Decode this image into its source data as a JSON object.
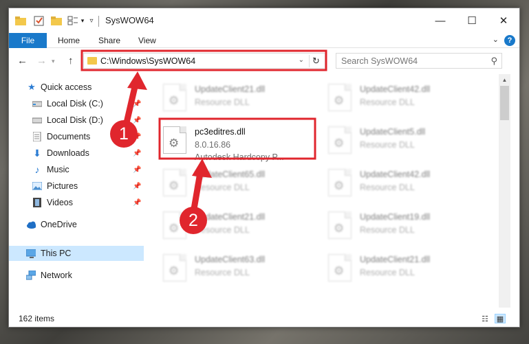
{
  "window": {
    "title": "SysWOW64",
    "controls": {
      "minimize": "—",
      "maximize": "☐",
      "close": "✕"
    }
  },
  "ribbon": {
    "tabs": [
      "File",
      "Home",
      "Share",
      "View"
    ],
    "help": "?"
  },
  "address_bar": {
    "path": "C:\\Windows\\SysWOW64"
  },
  "search": {
    "placeholder": "Search SysWOW64"
  },
  "sidebar": {
    "quick_access": "Quick access",
    "items": [
      {
        "label": "Local Disk (C:)",
        "icon": "drive-icon",
        "pinned": true
      },
      {
        "label": "Local Disk (D:)",
        "icon": "drive-icon",
        "pinned": true
      },
      {
        "label": "Documents",
        "icon": "documents-icon",
        "pinned": true
      },
      {
        "label": "Downloads",
        "icon": "downloads-icon",
        "pinned": true
      },
      {
        "label": "Music",
        "icon": "music-icon",
        "pinned": true
      },
      {
        "label": "Pictures",
        "icon": "pictures-icon",
        "pinned": true
      },
      {
        "label": "Videos",
        "icon": "videos-icon",
        "pinned": true
      }
    ],
    "onedrive": "OneDrive",
    "this_pc": "This PC",
    "network": "Network"
  },
  "files": {
    "highlighted": {
      "name": "pc3editres.dll",
      "version": "8.0.16.86",
      "description": "Autodesk Hardcopy P..."
    },
    "blurred": [
      {
        "name": "UpdateClient21.dll",
        "desc": "Resource DLL"
      },
      {
        "name": "UpdateClient42.dll",
        "desc": "Resource DLL"
      },
      {
        "name": "UpdateClient5.dll",
        "desc": "Resource DLL"
      },
      {
        "name": "UpdateClient65.dll",
        "desc": "Resource DLL"
      },
      {
        "name": "UpdateClient42.dll",
        "desc": "Resource DLL"
      },
      {
        "name": "UpdateClient21.dll",
        "desc": "Resource DLL"
      },
      {
        "name": "UpdateClient19.dll",
        "desc": "Resource DLL"
      },
      {
        "name": "UpdateClient63.dll",
        "desc": "Resource DLL"
      },
      {
        "name": "UpdateClient21.dll",
        "desc": "Resource DLL"
      }
    ]
  },
  "status": {
    "item_count": "162 items"
  },
  "annotations": {
    "step1": "1",
    "step2": "2",
    "color": "#e0262d"
  }
}
